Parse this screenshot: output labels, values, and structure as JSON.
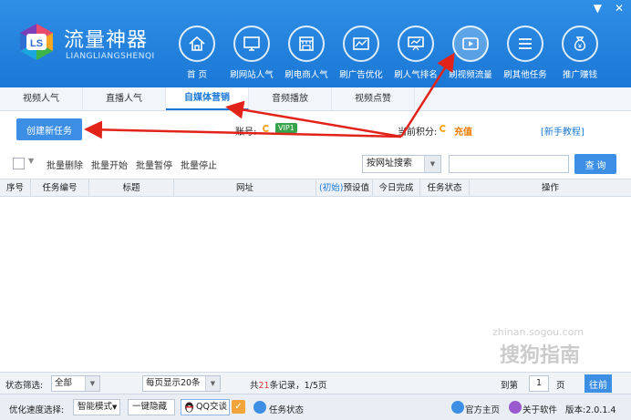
{
  "window": {
    "minimize": "▼",
    "close": "✕"
  },
  "app": {
    "title": "流量神器",
    "subtitle": "LIANGLIANGSHENQI",
    "logo_text": "LS"
  },
  "nav": [
    {
      "label": "首 页",
      "icon": "home-icon"
    },
    {
      "label": "刷网站人气",
      "icon": "monitor-icon"
    },
    {
      "label": "刷电商人气",
      "icon": "store-icon"
    },
    {
      "label": "刷广告优化",
      "icon": "ad-chart-icon"
    },
    {
      "label": "刷人气排名",
      "icon": "presentation-icon"
    },
    {
      "label": "刷视频流量",
      "icon": "video-icon"
    },
    {
      "label": "刷其他任务",
      "icon": "list-icon"
    },
    {
      "label": "推广赚钱",
      "icon": "money-bag-icon"
    }
  ],
  "tabs": [
    {
      "label": "视频人气"
    },
    {
      "label": "直播人气"
    },
    {
      "label": "自媒体营销"
    },
    {
      "label": "音频播放"
    },
    {
      "label": "视频点赞"
    }
  ],
  "actions": {
    "create_task": "创建新任务",
    "account_label": "账号:",
    "vip": "VIP1",
    "points_label": "当前积分:",
    "recharge": "充值",
    "guide": "[新手教程]"
  },
  "toolbar": {
    "batch_delete": "批量删除",
    "batch_start": "批量开始",
    "batch_pause": "批量暂停",
    "batch_stop": "批量停止",
    "search_mode": "按网址搜索",
    "query": "查 询"
  },
  "table": {
    "columns": [
      "序号",
      "任务编号",
      "标题",
      "网址",
      "(初始)",
      "预设值",
      "今日完成",
      "任务状态",
      "操作"
    ]
  },
  "watermark": {
    "brand": "搜狗指南",
    "url": "zhinan.sogou.com"
  },
  "pager": {
    "status_filter_label": "状态筛选:",
    "status_filter_value": "全部",
    "per_page": "每页显示20条",
    "total_prefix": "共",
    "total_count": "21",
    "total_suffix": "条记录，1/5页",
    "goto_label": "到第",
    "goto_page": "1",
    "page_unit": "页",
    "go": "往前"
  },
  "statusbar": {
    "speed_label": "优化速度选择:",
    "speed_value": "智能模式",
    "hide": "一键隐藏",
    "qq": "QQ交谈",
    "task_status": "任务状态",
    "homepage": "官方主页",
    "about": "关于软件",
    "version": "版本:2.0.1.4"
  },
  "colors": {
    "header": "#1b78d6",
    "accent": "#3c8fe4",
    "vip": "#36a24a",
    "recharge": "#ee7b00",
    "arrow": "#e2231a"
  }
}
